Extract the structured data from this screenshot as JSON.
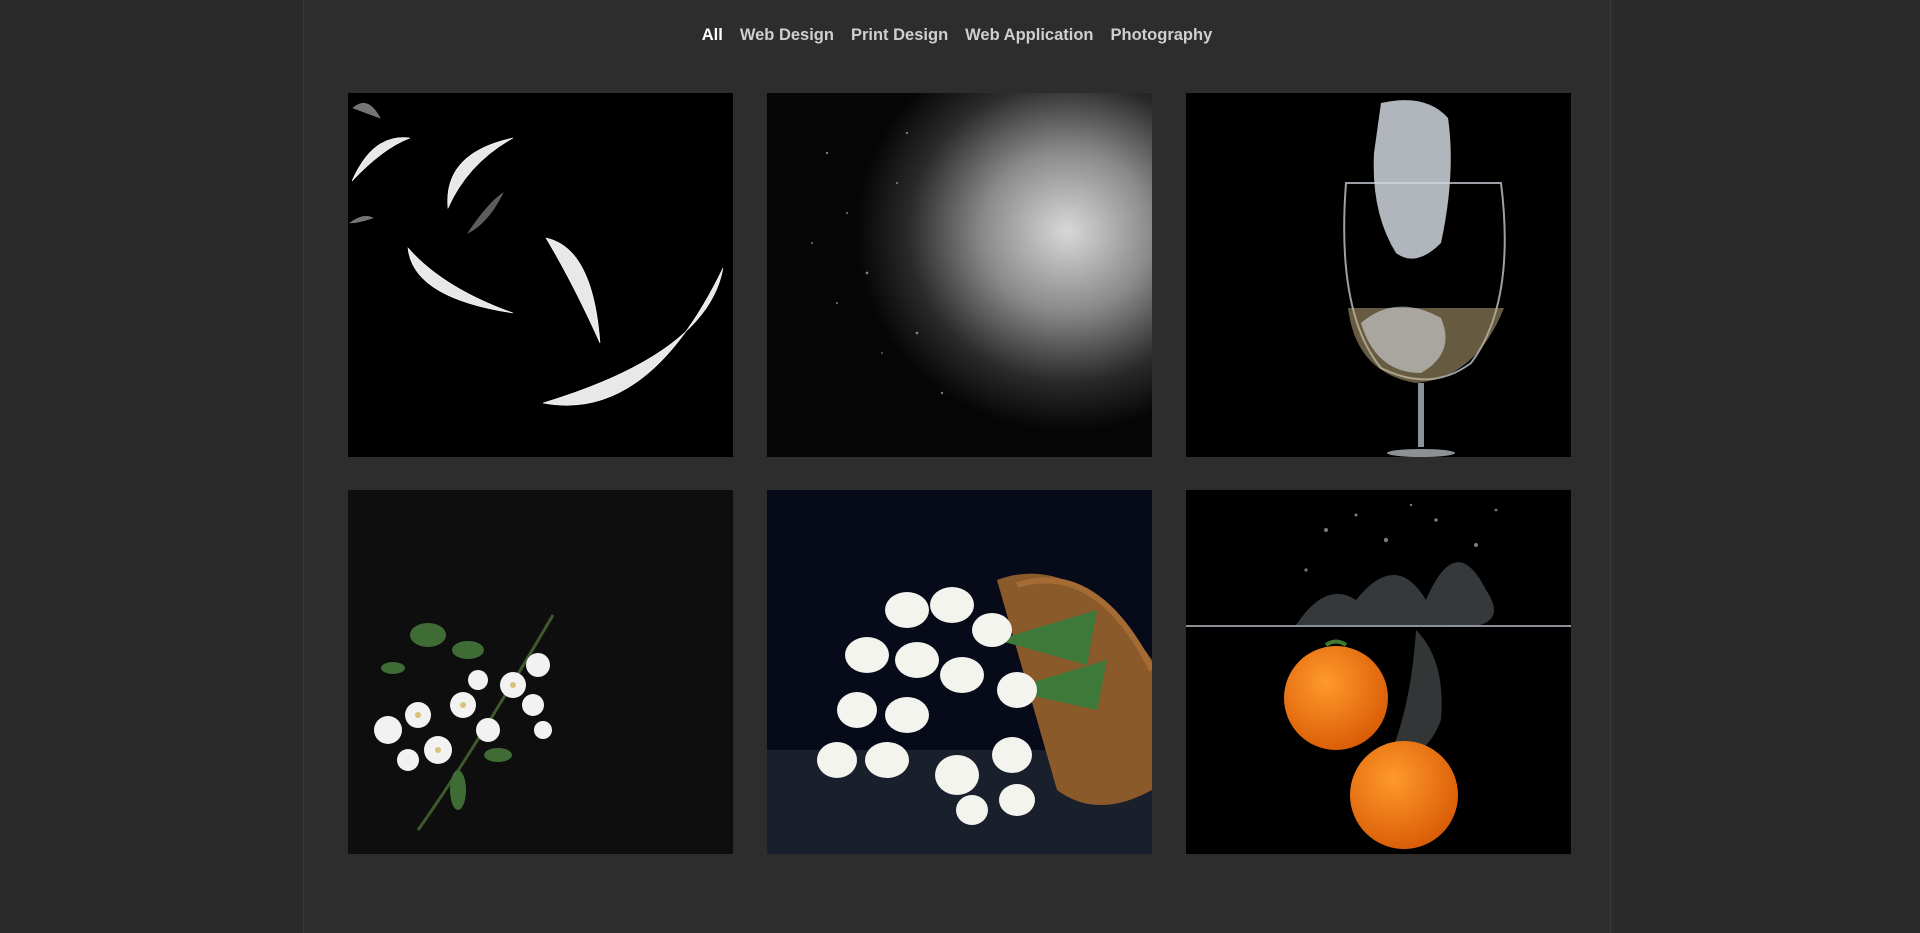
{
  "filters": {
    "items": [
      {
        "label": "All",
        "active": true
      },
      {
        "label": "Web Design",
        "active": false
      },
      {
        "label": "Print Design",
        "active": false
      },
      {
        "label": "Web Application",
        "active": false
      },
      {
        "label": "Photography",
        "active": false
      }
    ]
  },
  "portfolio": {
    "tiles": [
      {
        "subject": "white feathers falling"
      },
      {
        "subject": "white powder explosion"
      },
      {
        "subject": "ice in wine glass"
      },
      {
        "subject": "white blossom branch"
      },
      {
        "subject": "white tulips in basket"
      },
      {
        "subject": "tomatoes splashing in water"
      }
    ]
  },
  "colors": {
    "page_bg": "#2b2b2b",
    "container_bg": "#2d2d2d",
    "filter_text": "#cfcfcf",
    "filter_active": "#ffffff"
  }
}
